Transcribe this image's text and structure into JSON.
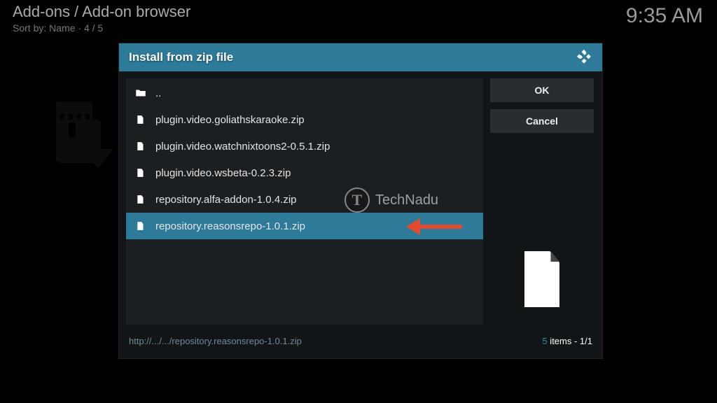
{
  "header": {
    "title": "Add-ons / Add-on browser",
    "sort_label": "Sort by:",
    "sort_value": "Name",
    "position": "4 / 5"
  },
  "clock": "9:35 AM",
  "dialog": {
    "title": "Install from zip file",
    "ok_label": "OK",
    "cancel_label": "Cancel",
    "files": [
      {
        "icon": "folder-up-icon",
        "label": "..",
        "selected": false
      },
      {
        "icon": "file-icon",
        "label": "plugin.video.goliathskaraoke.zip",
        "selected": false
      },
      {
        "icon": "file-icon",
        "label": "plugin.video.watchnixtoons2-0.5.1.zip",
        "selected": false
      },
      {
        "icon": "file-icon",
        "label": "plugin.video.wsbeta-0.2.3.zip",
        "selected": false
      },
      {
        "icon": "file-icon",
        "label": "repository.alfa-addon-1.0.4.zip",
        "selected": false
      },
      {
        "icon": "file-icon",
        "label": "repository.reasonsrepo-1.0.1.zip",
        "selected": true
      }
    ],
    "status_path": "http://.../.../repository.reasonsrepo-1.0.1.zip",
    "items_count": "5",
    "items_suffix": " items - ",
    "page": "1/1"
  },
  "watermark": "TechNadu"
}
